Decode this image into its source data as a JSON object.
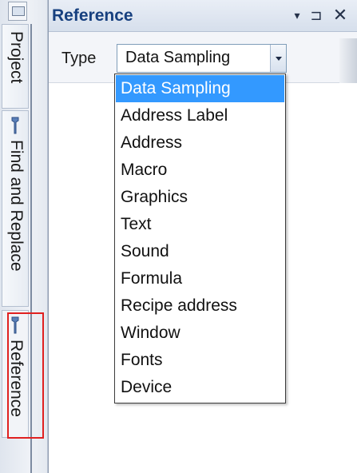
{
  "side_tabs": [
    {
      "label": "Project",
      "icon": "project-icon"
    },
    {
      "label": "Find and Replace",
      "icon": "wrench-icon"
    },
    {
      "label": "Reference",
      "icon": "wrench-icon",
      "highlighted": true
    }
  ],
  "panel": {
    "title": "Reference",
    "buttons": {
      "dropdown": "▾",
      "pin": "⊐",
      "close": "✕"
    }
  },
  "filter": {
    "label": "Type",
    "selected": "Data Sampling"
  },
  "dropdown": {
    "options": [
      "Data Sampling",
      "Address Label",
      "Address",
      "Macro",
      "Graphics",
      "Text",
      "Sound",
      "Formula",
      "Recipe address",
      "Window",
      "Fonts",
      "Device"
    ],
    "selected_index": 0
  },
  "colors": {
    "highlight": "#3399ff",
    "title": "#17407f",
    "annotation_box": "#e02020"
  }
}
